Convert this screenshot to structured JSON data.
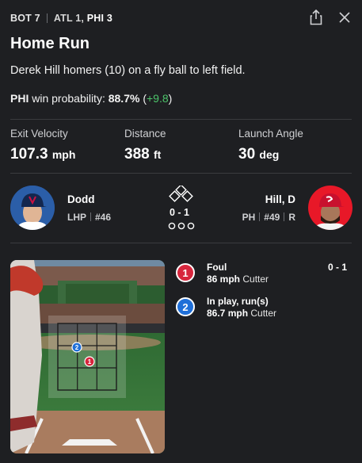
{
  "header": {
    "inning": "BOT 7",
    "score_away": "ATL 1,",
    "score_home": "PHI 3",
    "share_icon": "share-icon",
    "close_icon": "close-icon"
  },
  "play": {
    "title": "Home Run",
    "description": "Derek Hill homers (10) on a fly ball to left field.",
    "wp_team": "PHI",
    "wp_label": "win probability:",
    "wp_value": "88.7%",
    "wp_change_open": "(",
    "wp_change": "+9.8",
    "wp_change_close": ")"
  },
  "stats": [
    {
      "label": "Exit Velocity",
      "value": "107.3",
      "unit": "mph"
    },
    {
      "label": "Distance",
      "value": "388",
      "unit": "ft"
    },
    {
      "label": "Launch Angle",
      "value": "30",
      "unit": "deg"
    }
  ],
  "matchup": {
    "pitcher": {
      "name": "Dodd",
      "hand": "LHP",
      "number": "#46"
    },
    "batter": {
      "name": "Hill, D",
      "pos": "PH",
      "number": "#49",
      "bats": "R"
    },
    "count": "0 - 1",
    "outs": 0,
    "bases_occupied": [
      false,
      false,
      false
    ]
  },
  "pitches": [
    {
      "num": "1",
      "result": "Foul",
      "speed": "86 mph",
      "type": "Cutter",
      "count": "0 - 1",
      "color": "#d7263d"
    },
    {
      "num": "2",
      "result": "In play, run(s)",
      "speed": "86.7 mph",
      "type": "Cutter",
      "count": "",
      "color": "#1f6fd8"
    }
  ],
  "colors": {
    "background": "#1e1f22",
    "positive": "#4cc46a",
    "pitch_red": "#d7263d",
    "pitch_blue": "#1f6fd8"
  }
}
